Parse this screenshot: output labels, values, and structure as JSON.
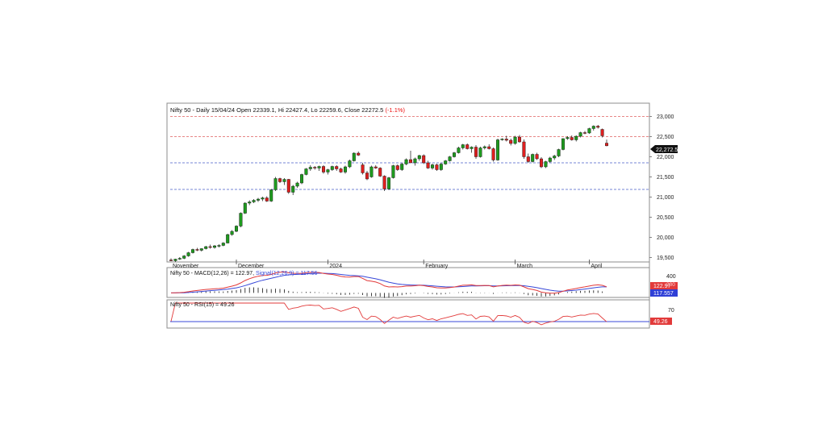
{
  "chart_data": {
    "type": "candlestick",
    "instrument": "Nifty 50",
    "header": {
      "prefix": "Nifty 50 - Daily 15/04/24 Open 22339.1, Hi 22427.4, Lo 22259.6, Close 22272.5 ",
      "change": "(-1.1%)"
    },
    "price_axis": {
      "ticks": [
        23000,
        22500,
        22000,
        21500,
        21000,
        20500,
        20000,
        19500
      ],
      "tick_labels": [
        "23,000",
        "22,500",
        "22,000",
        "21,500",
        "21,000",
        "20,500",
        "20,000",
        "19,500"
      ],
      "range": [
        19390,
        23330
      ]
    },
    "current_price_label": "22,272.5",
    "horizontal_levels": [
      {
        "value": 23000,
        "style": "dashed",
        "color": "#e06060"
      },
      {
        "value": 22500,
        "style": "dashed",
        "color": "#e06060"
      },
      {
        "value": 21850,
        "style": "dashed",
        "color": "#4a5ec8"
      },
      {
        "value": 21190,
        "style": "dashed",
        "color": "#4a5ec8"
      }
    ],
    "x_labels": [
      "November",
      "December",
      "2024",
      "February",
      "March",
      "April"
    ],
    "colors": {
      "up": "#1f9a1f",
      "down": "#dd1f1f"
    },
    "candles": [
      [
        19440,
        19480,
        19410,
        19420
      ],
      [
        19420,
        19470,
        19390,
        19460
      ],
      [
        19460,
        19510,
        19440,
        19480
      ],
      [
        19480,
        19560,
        19460,
        19540
      ],
      [
        19540,
        19640,
        19520,
        19620
      ],
      [
        19620,
        19720,
        19600,
        19700
      ],
      [
        19700,
        19740,
        19660,
        19680
      ],
      [
        19680,
        19730,
        19650,
        19720
      ],
      [
        19720,
        19790,
        19700,
        19770
      ],
      [
        19770,
        19820,
        19720,
        19750
      ],
      [
        19750,
        19810,
        19720,
        19790
      ],
      [
        19790,
        19830,
        19750,
        19800
      ],
      [
        19800,
        19880,
        19780,
        19860
      ],
      [
        19860,
        20090,
        19850,
        20070
      ],
      [
        20070,
        20180,
        20040,
        20150
      ],
      [
        20150,
        20300,
        20130,
        20280
      ],
      [
        20280,
        20620,
        20250,
        20600
      ],
      [
        20600,
        20870,
        20580,
        20850
      ],
      [
        20850,
        20920,
        20800,
        20880
      ],
      [
        20880,
        20950,
        20850,
        20920
      ],
      [
        20920,
        20980,
        20880,
        20950
      ],
      [
        20950,
        21010,
        20900,
        20980
      ],
      [
        20980,
        21020,
        20880,
        20900
      ],
      [
        20900,
        21200,
        20880,
        21180
      ],
      [
        21180,
        21500,
        21150,
        21460
      ],
      [
        21460,
        21480,
        21350,
        21380
      ],
      [
        21380,
        21470,
        21300,
        21440
      ],
      [
        21440,
        21450,
        21080,
        21120
      ],
      [
        21120,
        21300,
        21050,
        21270
      ],
      [
        21270,
        21380,
        21230,
        21350
      ],
      [
        21350,
        21580,
        21320,
        21560
      ],
      [
        21560,
        21720,
        21540,
        21700
      ],
      [
        21700,
        21790,
        21650,
        21740
      ],
      [
        21740,
        21770,
        21680,
        21720
      ],
      [
        21720,
        21780,
        21650,
        21760
      ],
      [
        21760,
        21790,
        21580,
        21620
      ],
      [
        21620,
        21700,
        21560,
        21680
      ],
      [
        21680,
        21780,
        21650,
        21760
      ],
      [
        21760,
        21790,
        21650,
        21700
      ],
      [
        21700,
        21730,
        21600,
        21620
      ],
      [
        21620,
        21780,
        21580,
        21750
      ],
      [
        21750,
        21930,
        21720,
        21900
      ],
      [
        21900,
        22110,
        21880,
        22090
      ],
      [
        22090,
        22130,
        22020,
        22040
      ],
      [
        21800,
        21850,
        21560,
        21600
      ],
      [
        21600,
        21650,
        21420,
        21450
      ],
      [
        21500,
        21780,
        21480,
        21750
      ],
      [
        21750,
        21790,
        21700,
        21720
      ],
      [
        21720,
        21740,
        21500,
        21520
      ],
      [
        21520,
        21540,
        21150,
        21200
      ],
      [
        21200,
        21500,
        21180,
        21480
      ],
      [
        21480,
        21800,
        21460,
        21780
      ],
      [
        21780,
        21810,
        21650,
        21680
      ],
      [
        21680,
        21850,
        21650,
        21820
      ],
      [
        21820,
        21960,
        21790,
        21930
      ],
      [
        21930,
        22150,
        21900,
        21850
      ],
      [
        21850,
        21980,
        21780,
        21950
      ],
      [
        21950,
        22050,
        21900,
        22030
      ],
      [
        22030,
        22060,
        21820,
        21850
      ],
      [
        21850,
        21900,
        21700,
        21720
      ],
      [
        21720,
        21830,
        21680,
        21800
      ],
      [
        21800,
        21830,
        21650,
        21680
      ],
      [
        21680,
        21850,
        21650,
        21820
      ],
      [
        21820,
        21920,
        21800,
        21900
      ],
      [
        21900,
        22020,
        21880,
        22000
      ],
      [
        22000,
        22120,
        21980,
        22100
      ],
      [
        22100,
        22250,
        22080,
        22220
      ],
      [
        22220,
        22320,
        22180,
        22300
      ],
      [
        22300,
        22330,
        22180,
        22200
      ],
      [
        22200,
        22260,
        22100,
        22240
      ],
      [
        22240,
        22290,
        21950,
        22000
      ],
      [
        22000,
        22250,
        21980,
        22220
      ],
      [
        22220,
        22280,
        22180,
        22250
      ],
      [
        22250,
        22310,
        22180,
        22200
      ],
      [
        22200,
        22230,
        21880,
        21920
      ],
      [
        21920,
        22450,
        21900,
        22420
      ],
      [
        22420,
        22460,
        22400,
        22440
      ],
      [
        22440,
        22520,
        22380,
        22410
      ],
      [
        22410,
        22450,
        22280,
        22330
      ],
      [
        22330,
        22520,
        22300,
        22490
      ],
      [
        22490,
        22540,
        22350,
        22370
      ],
      [
        22370,
        22430,
        21950,
        22000
      ],
      [
        22000,
        22080,
        21850,
        21880
      ],
      [
        21880,
        22080,
        21860,
        22060
      ],
      [
        22060,
        22100,
        21920,
        21950
      ],
      [
        21950,
        21990,
        21720,
        21750
      ],
      [
        21750,
        21900,
        21720,
        21880
      ],
      [
        21880,
        22000,
        21850,
        21970
      ],
      [
        21970,
        22050,
        21920,
        22020
      ],
      [
        22020,
        22200,
        21990,
        22180
      ],
      [
        22180,
        22460,
        22160,
        22450
      ],
      [
        22450,
        22510,
        22420,
        22480
      ],
      [
        22480,
        22530,
        22400,
        22420
      ],
      [
        22420,
        22530,
        22380,
        22510
      ],
      [
        22510,
        22620,
        22480,
        22600
      ],
      [
        22600,
        22640,
        22560,
        22590
      ],
      [
        22590,
        22720,
        22570,
        22700
      ],
      [
        22700,
        22780,
        22650,
        22760
      ],
      [
        22760,
        22790,
        22700,
        22730
      ],
      [
        22680,
        22700,
        22480,
        22520
      ],
      [
        22339.1,
        22427.4,
        22259.6,
        22272.5
      ]
    ],
    "macd": {
      "label": "Nifty 50 - MACD(12,26) = 122.97, Signal(12,26,9) = 117.56",
      "label_prefix": "Nifty 50 - MACD(12,26) = 122.97, ",
      "label_signal": "Signal(12,26,9) = 117.56",
      "macd_value": 122.97,
      "signal_value": 117.56,
      "axis_tick": "400",
      "axis_tick_value": 400,
      "axis_label_200": "200",
      "macd_value_label": "122.97",
      "signal_value_label": "117.557",
      "range": [
        -80,
        480
      ],
      "macd_color": "#e23a3a",
      "signal_color": "#3848d8"
    },
    "rsi": {
      "label": "Nifty 50 - RSI(15) = 49.26",
      "value": 49.26,
      "axis_tick": "70",
      "axis_tick_value": 70,
      "level_label": "49.26",
      "range": [
        40,
        85
      ],
      "line_color": "#e23a3a",
      "level_color": "#3848d8"
    }
  }
}
